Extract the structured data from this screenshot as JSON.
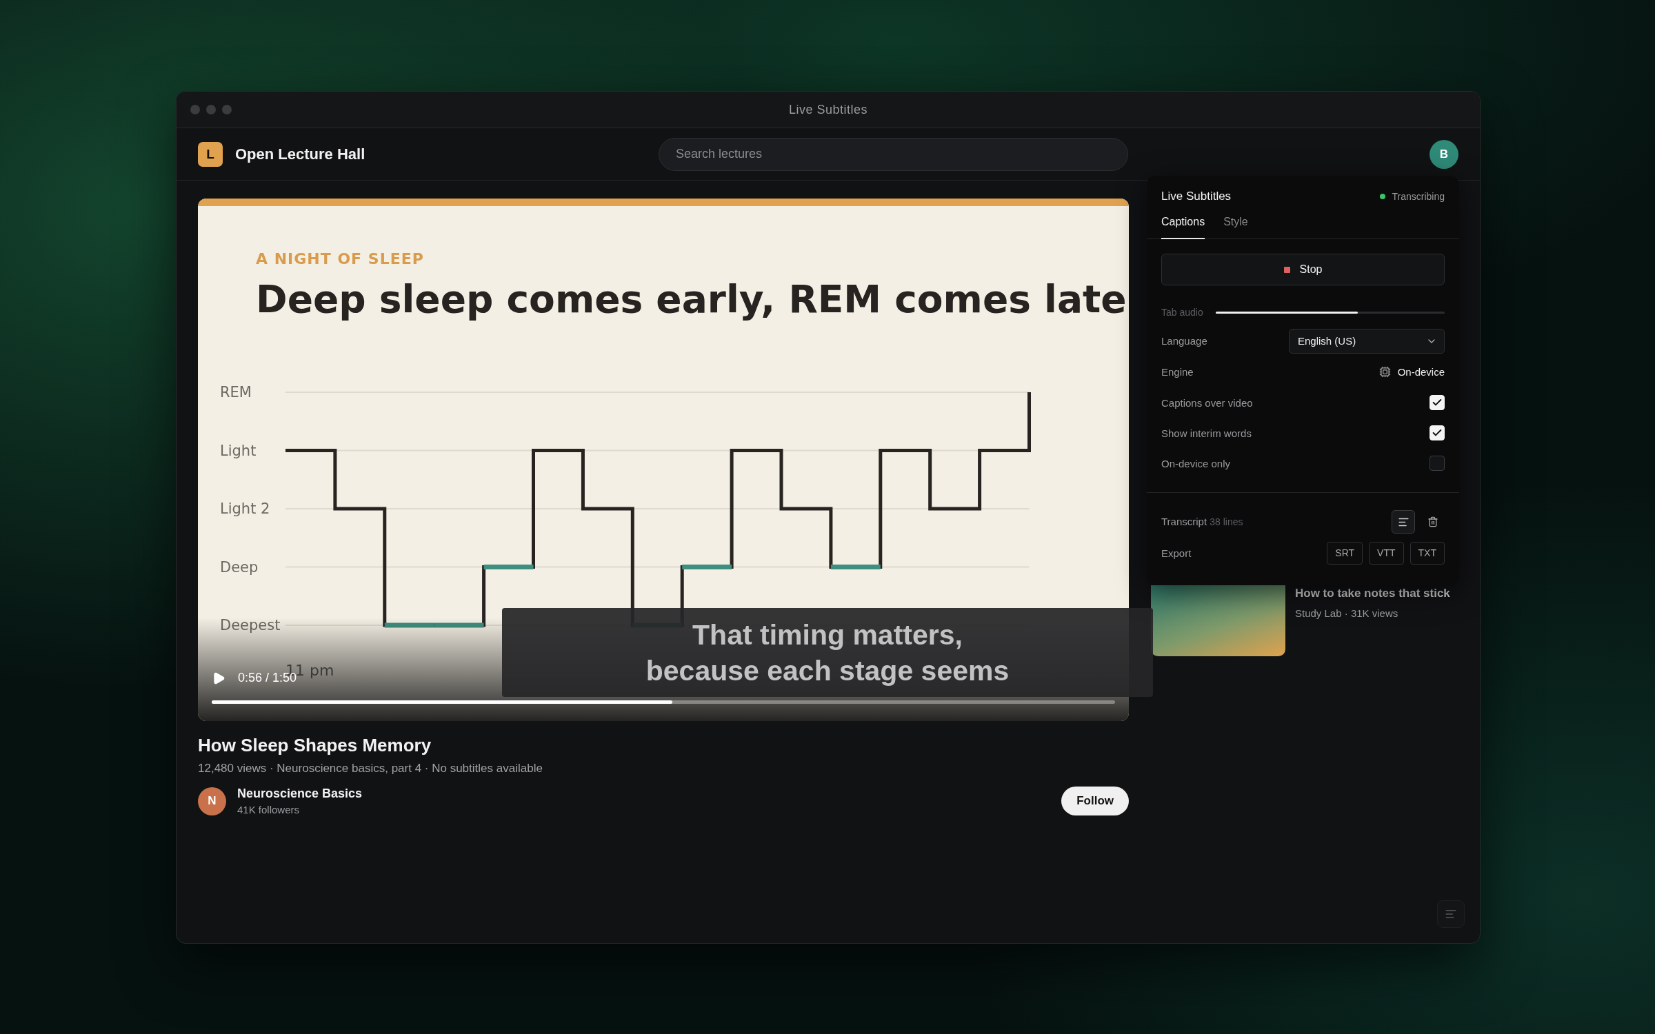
{
  "window": {
    "title": "Live Subtitles"
  },
  "header": {
    "logo_letter": "L",
    "site_name": "Open Lecture Hall",
    "search": {
      "placeholder": "Search lectures"
    },
    "avatar_letter": "B"
  },
  "video": {
    "slide": {
      "eyebrow": "A NIGHT OF SLEEP",
      "title": "Deep sleep comes early, REM comes late",
      "stage_labels": [
        "REM",
        "Light",
        "Light 2",
        "Deep",
        "Deepest"
      ],
      "time_label": "11 pm"
    },
    "caption_lines": [
      "That timing matters,",
      "because each stage seems"
    ],
    "time": "0:56 / 1:50",
    "progress": {
      "level": 0.51
    }
  },
  "video_info": {
    "title": "How Sleep Shapes Memory",
    "meta": "12,480 views · Neuroscience basics, part 4 · No subtitles available",
    "channel": {
      "avatar_letter": "N",
      "name": "Neuroscience Basics",
      "followers": "41K followers",
      "follow_button": "Follow"
    }
  },
  "recommendations": [
    {
      "title": "How to take notes that stick",
      "meta": "Study Lab · 31K views"
    }
  ],
  "subtitles_panel": {
    "title": "Live Subtitles",
    "status": "Transcribing",
    "tabs": [
      {
        "label": "Captions",
        "selected": true
      },
      {
        "label": "Style",
        "selected": false
      }
    ],
    "stop_button": "Stop",
    "settings": [
      {
        "kind": "slider",
        "label": "Tab audio",
        "level": 0.62
      },
      {
        "kind": "select",
        "label": "Language",
        "value": "English (US)"
      },
      {
        "kind": "value",
        "label": "Engine",
        "value": "On-device"
      },
      {
        "kind": "checkbox",
        "label": "Captions over video",
        "checked": true
      },
      {
        "kind": "checkbox",
        "label": "Show interim words",
        "checked": true
      },
      {
        "kind": "checkbox",
        "label": "On-device only",
        "checked": false
      }
    ],
    "transcript": {
      "label": "Transcript",
      "count": "38 lines"
    },
    "export": {
      "label": "Export",
      "formats": [
        "SRT",
        "VTT",
        "TXT"
      ]
    }
  }
}
